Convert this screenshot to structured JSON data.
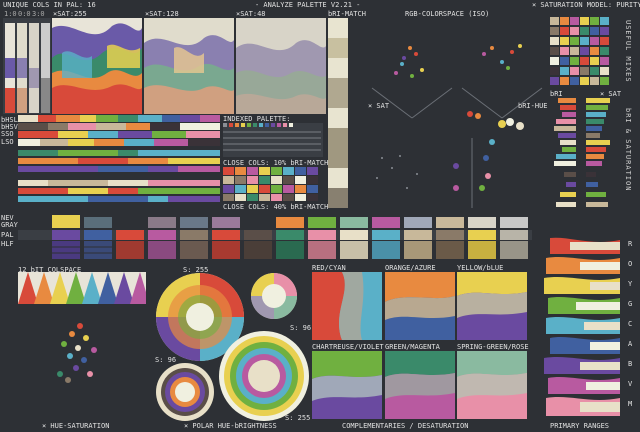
{
  "header": {
    "unique_cols": "UNIQUE COLS IN PAL: 16",
    "title": "- ANALYZE PALETTE V2.21 -",
    "saturation_model": "⨯ SATURATION MODEL: PURITY"
  },
  "top_charts": {
    "sat_all": "⨯SAT:255",
    "sat_128": "⨯SAT:128",
    "sat_48": "⨯SAT:48",
    "bri_match": "bRI-MATCH",
    "small_tags": [
      "1:0",
      "0:0",
      "3:0"
    ]
  },
  "rgb": {
    "title": "RGB-COLORSPACE (ISO)",
    "sat_axis": "⨯ SAT",
    "bri_hue_axis": "bRI-HUE"
  },
  "indexed": {
    "title": "INDEXED PALETTE:"
  },
  "close_cols": {
    "bri_10": "CLOSE COLS: 10% bRI-MATCH",
    "bri_40": "CLOSE COLS: 40% bRI-MATCH"
  },
  "left_labels": [
    "bHSL",
    "bHSV",
    "SSO",
    "LSO"
  ],
  "gray_labels": [
    "NEV",
    "GRAY",
    "PAL",
    "HLF"
  ],
  "side_right": {
    "useful_mixes": "USEFUL MIXES",
    "sat_label": "⨯ SAT",
    "bri_label": "bRI",
    "bri_saturation": "bRI & SATURATION",
    "hue_letters": [
      "R",
      "O",
      "Y",
      "G",
      "C",
      "A",
      "B",
      "V",
      "M"
    ]
  },
  "colspace": {
    "title": "12 bIT COLSPACE"
  },
  "polar": {
    "s255": "S: 255",
    "s96": "S: 96",
    "s96b": "S: 96",
    "s255b": "S: 255"
  },
  "complementaries": {
    "pairs": [
      "RED/CYAN",
      "ORANGE/AZURE",
      "YELLOW/bLUE",
      "CHARTREUSE/VIOLET",
      "GREEN/MAGENTA",
      "SPRING-GREEN/ROSE"
    ]
  },
  "footer": {
    "hue_saturation": "⨯ HUE-SATURATION",
    "polar_hue_bri": "⨯ POLAR HUE-bRIGHTNESS",
    "compl_desat": "COMPLEMENTARIES / DESATURATION",
    "primary_ranges": "PRIMARY RANGES"
  },
  "palette_colors": [
    "#e8e0c8",
    "#c8b89a",
    "#8a7a68",
    "#5a4e48",
    "#3a3238",
    "#d84a3a",
    "#e88a40",
    "#e8d050",
    "#70b040",
    "#3a8a6a",
    "#5ab0c8",
    "#4060a0",
    "#6a4aa0",
    "#b85aa0",
    "#e890a8",
    "#f0f0e0"
  ]
}
